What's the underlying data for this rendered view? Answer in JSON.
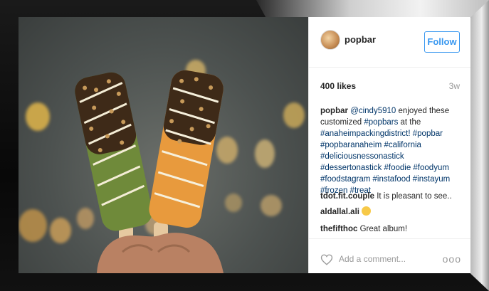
{
  "post": {
    "username": "popbar",
    "follow_label": "Follow",
    "likes": "400 likes",
    "age": "3w",
    "caption": {
      "user": "popbar",
      "mention": "@cindy5910",
      "text1": " enjoyed these customized ",
      "tag1": "#popbars",
      "text2": " at the ",
      "tags": "#anaheimpackingdistrict! #popbar #popbaranaheim #california #deliciousnessonastick #dessertonastick #foodie #foodyum #foodstagram #instafood #instayum #frozen #treat"
    },
    "comments": [
      {
        "user": "tdot.fit.couple",
        "text": " It is pleasant to see.."
      },
      {
        "user": "aldallal.ali",
        "text": ""
      },
      {
        "user": "thefifthoc",
        "text": " Great album!"
      }
    ],
    "add_comment_placeholder": "Add a comment...",
    "more_label": "ooo"
  },
  "icons": {
    "avatar": "avatar-image",
    "heart": "heart-icon",
    "smiley": "smiley-emoji"
  },
  "colors": {
    "follow_blue": "#3897f0",
    "hashtag": "#003569",
    "matcha": "#6f8a3a",
    "mango": "#e89a3d"
  }
}
